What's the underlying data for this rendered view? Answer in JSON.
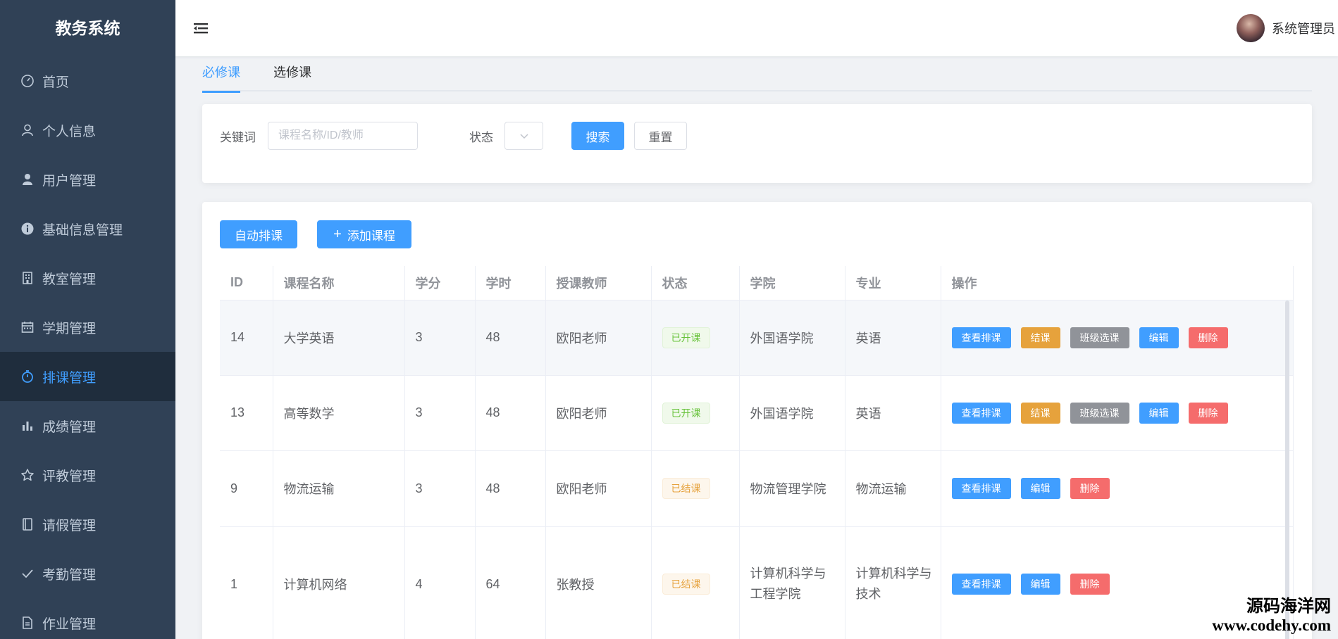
{
  "app": {
    "title": "教务系统"
  },
  "sidebar": {
    "items": [
      {
        "label": "首页",
        "icon": "dashboard-icon"
      },
      {
        "label": "个人信息",
        "icon": "user-icon"
      },
      {
        "label": "用户管理",
        "icon": "user-filled-icon"
      },
      {
        "label": "基础信息管理",
        "icon": "info-icon"
      },
      {
        "label": "教室管理",
        "icon": "building-icon"
      },
      {
        "label": "学期管理",
        "icon": "calendar-icon"
      },
      {
        "label": "排课管理",
        "icon": "timer-icon",
        "active": true
      },
      {
        "label": "成绩管理",
        "icon": "bar-chart-icon"
      },
      {
        "label": "评教管理",
        "icon": "star-icon"
      },
      {
        "label": "请假管理",
        "icon": "notebook-icon"
      },
      {
        "label": "考勤管理",
        "icon": "check-icon"
      },
      {
        "label": "作业管理",
        "icon": "document-icon"
      }
    ]
  },
  "header": {
    "user_name": "系统管理员"
  },
  "tabs": [
    {
      "label": "必修课",
      "active": true
    },
    {
      "label": "选修课"
    }
  ],
  "search": {
    "keyword_label": "关键词",
    "keyword_placeholder": "课程名称/ID/教师",
    "status_label": "状态",
    "search_button": "搜索",
    "reset_button": "重置"
  },
  "toolbar": {
    "auto_schedule": "自动排课",
    "add_course": "添加课程"
  },
  "table": {
    "columns": [
      "ID",
      "课程名称",
      "学分",
      "学时",
      "授课教师",
      "状态",
      "学院",
      "专业",
      "操作"
    ],
    "rows": [
      {
        "id": "14",
        "name": "大学英语",
        "credit": "3",
        "hours": "48",
        "teacher": "欧阳老师",
        "status": "已开课",
        "college": "外国语学院",
        "major": "英语",
        "actions": [
          "查看排课",
          "结课",
          "班级选课",
          "编辑",
          "删除"
        ]
      },
      {
        "id": "13",
        "name": "高等数学",
        "credit": "3",
        "hours": "48",
        "teacher": "欧阳老师",
        "status": "已开课",
        "college": "外国语学院",
        "major": "英语",
        "actions": [
          "查看排课",
          "结课",
          "班级选课",
          "编辑",
          "删除"
        ]
      },
      {
        "id": "9",
        "name": "物流运输",
        "credit": "3",
        "hours": "48",
        "teacher": "欧阳老师",
        "status": "已结课",
        "college": "物流管理学院",
        "major": "物流运输",
        "actions": [
          "查看排课",
          "编辑",
          "删除"
        ]
      },
      {
        "id": "1",
        "name": "计算机网络",
        "credit": "4",
        "hours": "64",
        "teacher": "张教授",
        "status": "已结课",
        "college": "计算机科学与工程学院",
        "major": "计算机科学与技术",
        "actions": [
          "查看排课",
          "编辑",
          "删除"
        ]
      }
    ]
  },
  "watermark": {
    "line1": "源码海洋网",
    "line2": "www.codehy.com"
  },
  "colors": {
    "sidebar_bg": "#304156",
    "primary": "#409eff",
    "warning": "#e6a23c",
    "danger": "#f56c6c",
    "info": "#909399",
    "success": "#67c23a"
  }
}
